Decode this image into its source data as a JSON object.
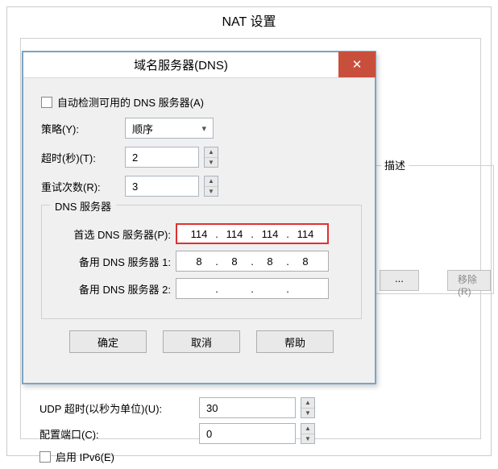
{
  "parent": {
    "title": "NAT 设置",
    "desc_label": "描述",
    "remove_btn": "移除(R)",
    "ellipsis_btn": "..."
  },
  "dialog": {
    "title": "域名服务器(DNS)",
    "close_glyph": "✕",
    "auto_detect_label": "自动检测可用的 DNS 服务器(A)",
    "auto_detect_checked": false,
    "policy_label": "策略(Y):",
    "policy_value": "顺序",
    "timeout_label": "超时(秒)(T):",
    "timeout_value": "2",
    "retry_label": "重试次数(R):",
    "retry_value": "3",
    "group_title": "DNS 服务器",
    "primary_label": "首选 DNS 服务器(P):",
    "primary_ip": [
      "114",
      "114",
      "114",
      "114"
    ],
    "alt1_label": "备用 DNS 服务器 1:",
    "alt1_ip": [
      "8",
      "8",
      "8",
      "8"
    ],
    "alt2_label": "备用 DNS 服务器 2:",
    "alt2_ip": [
      "",
      "",
      "",
      ""
    ],
    "ok": "确定",
    "cancel": "取消",
    "help": "帮助"
  },
  "lower": {
    "udp_label": "UDP 超时(以秒为单位)(U):",
    "udp_value": "30",
    "port_label": "配置端口(C):",
    "port_value": "0",
    "ipv6_label": "启用 IPv6(E)",
    "ipv6_checked": false
  }
}
